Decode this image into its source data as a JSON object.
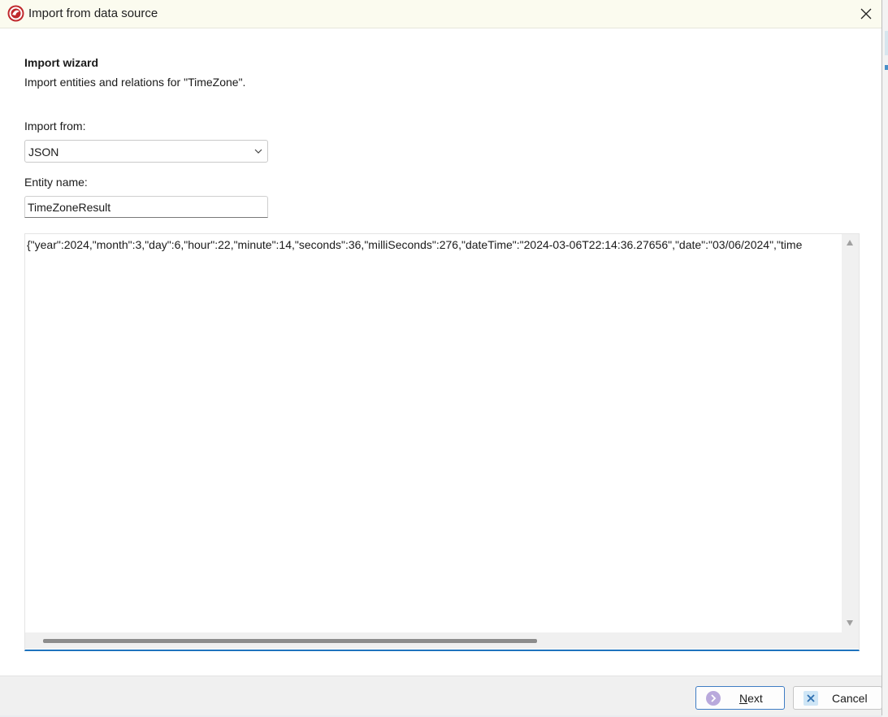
{
  "window": {
    "title": "Import from data source",
    "close_icon": "close-icon",
    "app_icon": "app-logo-icon"
  },
  "wizard": {
    "heading": "Import wizard",
    "description": "Import entities and relations for \"TimeZone\"."
  },
  "form": {
    "import_from_label": "Import from:",
    "import_from_value": "JSON",
    "entity_name_label": "Entity name:",
    "entity_name_value": "TimeZoneResult"
  },
  "editor": {
    "content": "{\"year\":2024,\"month\":3,\"day\":6,\"hour\":22,\"minute\":14,\"seconds\":36,\"milliSeconds\":276,\"dateTime\":\"2024-03-06T22:14:36.27656\",\"date\":\"03/06/2024\",\"time"
  },
  "buttons": {
    "next_label": "Next",
    "cancel_label": "Cancel"
  },
  "colors": {
    "accent": "#1e73be",
    "titlebar_bg": "#fbfbef",
    "next_icon": "#b9a9dc",
    "cancel_icon": "#2f6fb0"
  }
}
